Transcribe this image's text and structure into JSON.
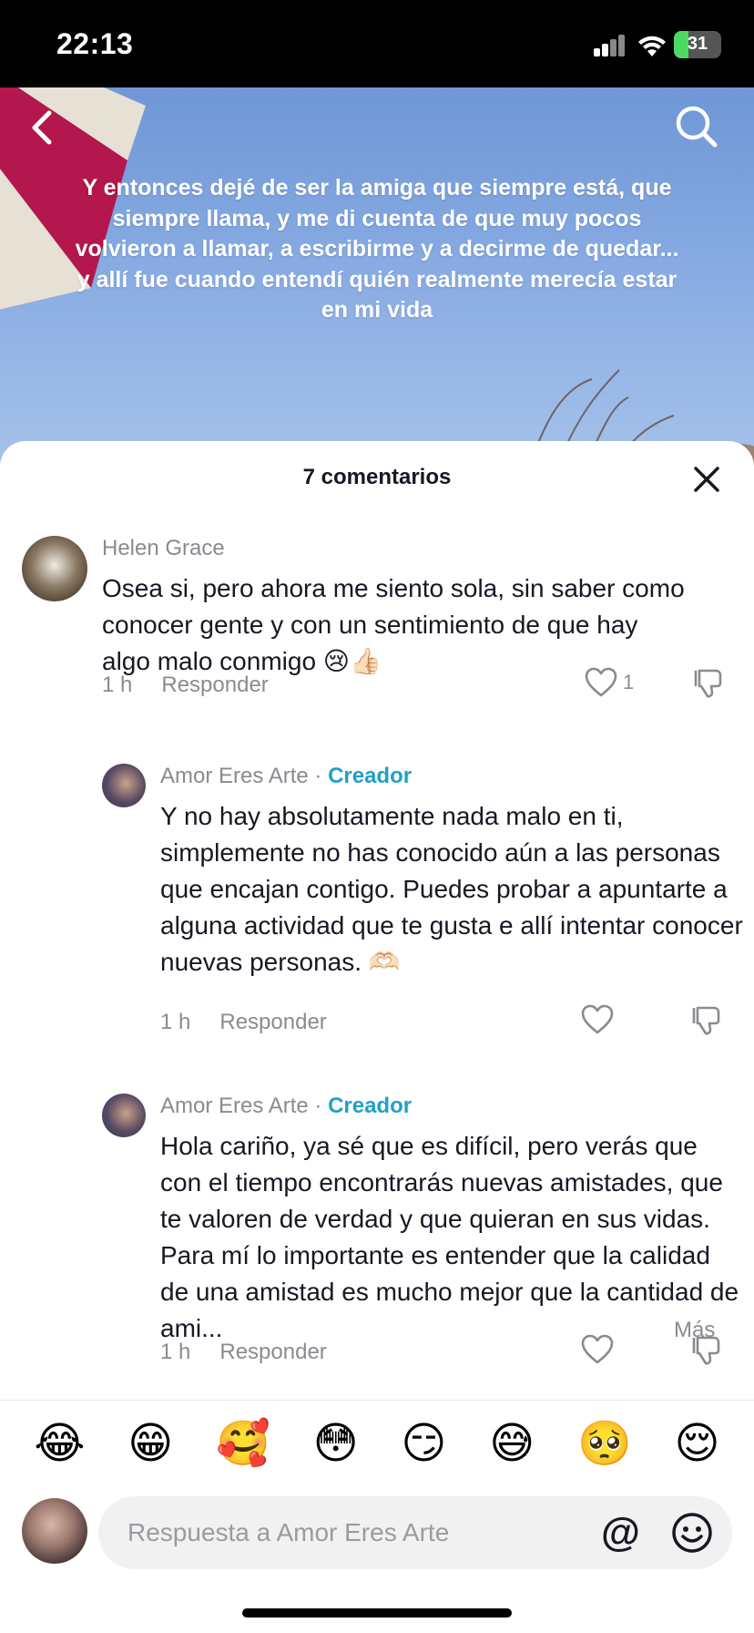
{
  "status_bar": {
    "time": "22:13",
    "battery": "31",
    "battery_level": 0.31,
    "colors": {
      "battery_fill": "#4cd964"
    }
  },
  "video": {
    "caption": "Y entonces dejé de ser la amiga que siempre está, que siempre llama, y me di cuenta de que muy pocos volvieron a llamar, a escribirme y a decirme de quedar... y allí fue cuando entendí quién realmente merecía estar en mi vida",
    "icons": {
      "back": "chevron-left-icon",
      "search": "search-icon"
    }
  },
  "comments_sheet": {
    "title": "7 comentarios",
    "comments": [
      {
        "author": "Helen Grace",
        "text": "Osea si, pero ahora me siento sola, sin saber como conocer gente y con un sentimiento de que hay algo malo conmigo 😢👍🏻",
        "time": "1 h",
        "reply_label": "Responder",
        "like_count": "1"
      },
      {
        "author": "Amor Eres Arte",
        "separator": "·",
        "badge": "Creador",
        "text": "Y no hay absolutamente nada malo en ti, simplemente no has conocido aún a las personas que encajan contigo. Puedes probar a apuntarte a alguna actividad que te gusta e allí intentar conocer nuevas personas. 🫶🏻",
        "time": "1 h",
        "reply_label": "Responder"
      },
      {
        "author": "Amor Eres Arte",
        "separator": "·",
        "badge": "Creador",
        "text": "Hola cariño, ya sé que es difícil, pero verás que con el tiempo encontrarás nuevas amistades, que te valoren de verdad y que quieran en sus vidas. Para mí lo importante es entender que la calidad de una amistad es mucho mejor que la cantidad de ami...",
        "more_label": "Más",
        "time": "1 h",
        "reply_label": "Responder"
      }
    ],
    "colors": {
      "creator": "#20a0c8",
      "text": "#161823",
      "muted": "#8a8b91"
    }
  },
  "emoji_bar": [
    "😂",
    "😁",
    "🥰",
    "😳",
    "😏",
    "😅",
    "🥺",
    "😌"
  ],
  "reply_input": {
    "placeholder": "Respuesta a Amor Eres Arte",
    "at_label": "@"
  }
}
